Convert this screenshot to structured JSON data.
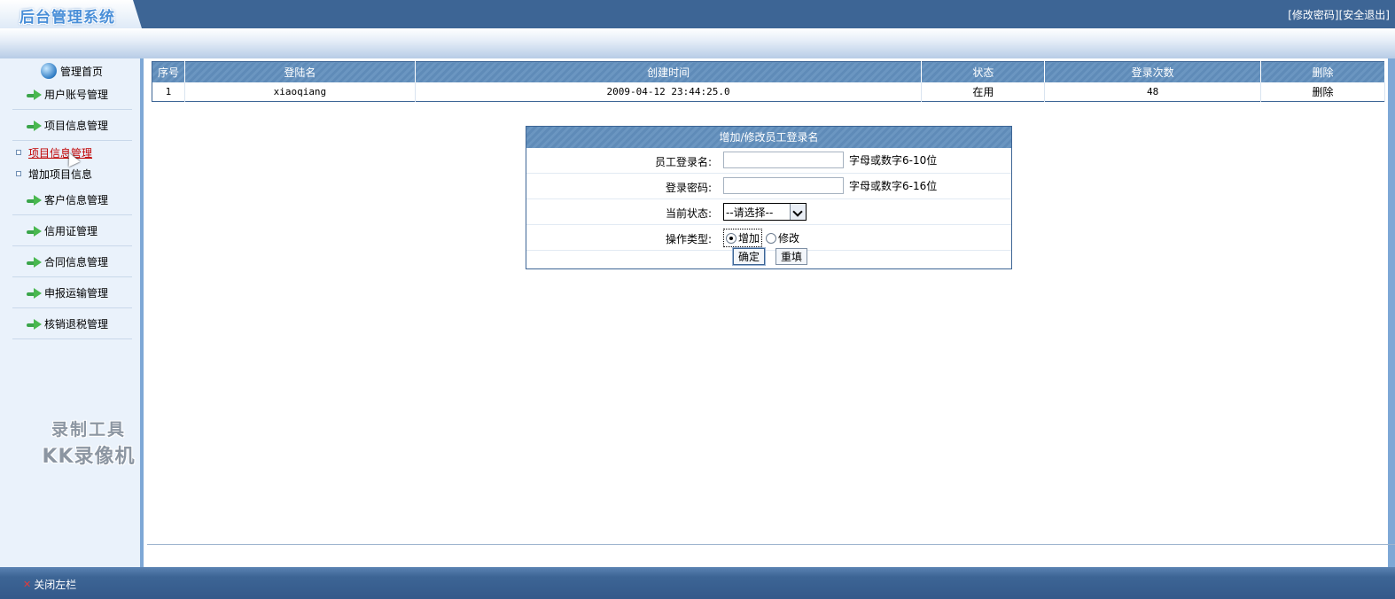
{
  "header": {
    "logo_text": "后台管理系统",
    "change_password": "[修改密码]",
    "logout": "[安全退出]"
  },
  "sidebar": {
    "home_label": "管理首页",
    "items": [
      {
        "label": "用户账号管理"
      },
      {
        "label": "项目信息管理"
      },
      {
        "label": "客户信息管理"
      },
      {
        "label": "信用证管理"
      },
      {
        "label": "合同信息管理"
      },
      {
        "label": "申报运输管理"
      },
      {
        "label": "核销退税管理"
      }
    ],
    "sub_items": [
      {
        "label": "项目信息管理"
      },
      {
        "label": "增加项目信息"
      }
    ]
  },
  "users_table": {
    "columns": [
      "序号",
      "登陆名",
      "创建时间",
      "状态",
      "登录次数",
      "删除"
    ],
    "rows": [
      {
        "index": "1",
        "login_name": "xiaoqiang",
        "created": "2009-04-12 23:44:25.0",
        "status": "在用",
        "login_count": "48",
        "delete": "删除"
      }
    ]
  },
  "form": {
    "title": "增加/修改员工登录名",
    "login_name_label": "员工登录名:",
    "login_name_value": "",
    "login_name_hint": "字母或数字6-10位",
    "password_label": "登录密码:",
    "password_value": "",
    "password_hint": "字母或数字6-16位",
    "status_label": "当前状态:",
    "status_selected": "--请选择--",
    "op_type_label": "操作类型:",
    "op_add": "增加",
    "op_modify": "修改",
    "submit": "确定",
    "reset": "重填"
  },
  "watermark": {
    "line1": "录制工具",
    "line2": "KK录像机"
  },
  "footer": {
    "close_sidebar": "关闭左栏"
  },
  "colors": {
    "header_bg": "#3d6595",
    "table_header_bg": "#5f8bb8",
    "active_link": "#c00000"
  }
}
